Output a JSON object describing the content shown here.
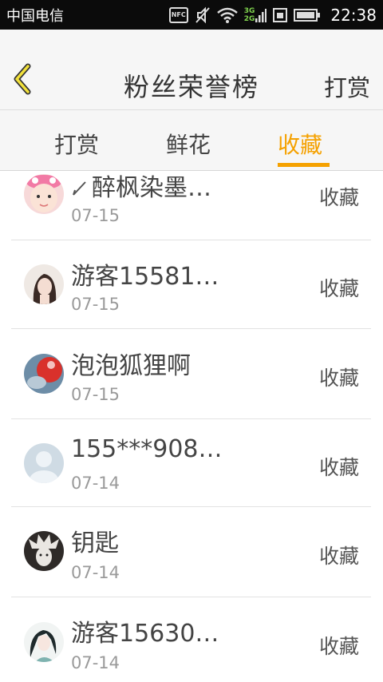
{
  "status_bar": {
    "carrier": "中国电信",
    "nfc_label": "NFC",
    "net_top": "3G",
    "net_bottom": "2G",
    "time": "22:38"
  },
  "header": {
    "title": "粉丝荣誉榜",
    "right_action": "打赏"
  },
  "tabs": [
    {
      "label": "打赏"
    },
    {
      "label": "鲜花"
    },
    {
      "label": "收藏"
    }
  ],
  "active_tab": "收藏",
  "accent_color": "#f5a100",
  "list": [
    {
      "name": "醉枫染墨…",
      "date": "07-15",
      "action": "收藏"
    },
    {
      "name": "游客15581…",
      "date": "07-15",
      "action": "收藏"
    },
    {
      "name": "泡泡狐狸啊",
      "date": "07-15",
      "action": "收藏"
    },
    {
      "name": "155***908…",
      "date": "07-14",
      "action": "收藏"
    },
    {
      "name": "钥匙",
      "date": "07-14",
      "action": "收藏"
    },
    {
      "name": "游客15630…",
      "date": "07-14",
      "action": "收藏"
    }
  ]
}
